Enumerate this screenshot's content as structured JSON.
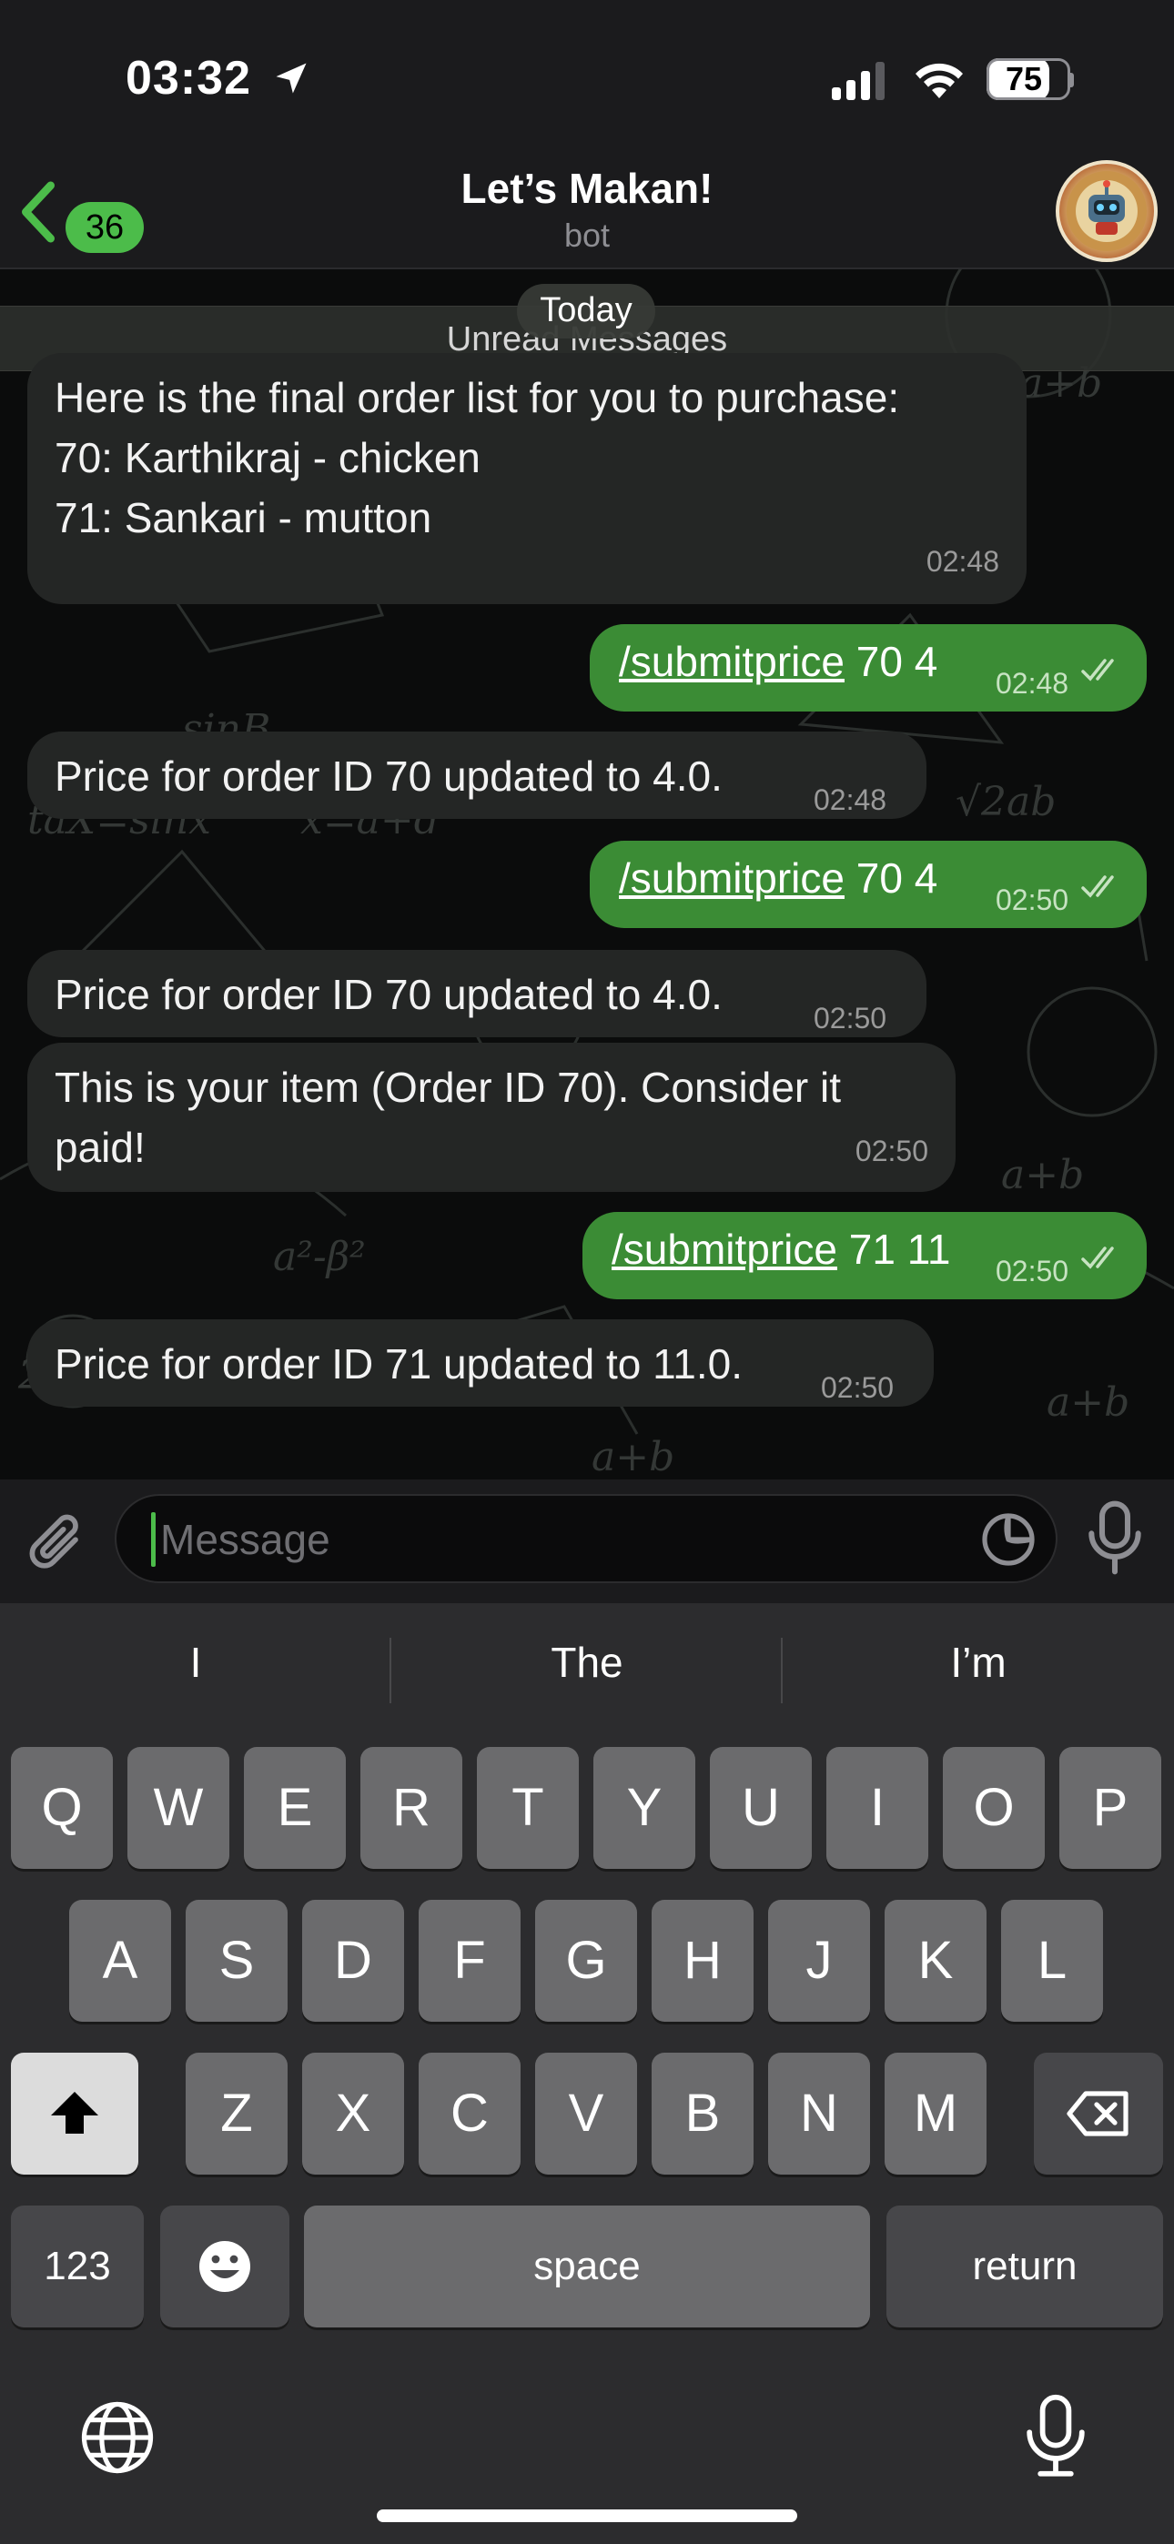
{
  "status_bar": {
    "time": "03:32",
    "battery_percent": "75",
    "battery_level": 0.75
  },
  "header": {
    "back_badge": "36",
    "title": "Let’s Makan!",
    "subtitle": "bot"
  },
  "chat": {
    "date_separator": "Today",
    "unread_label": "Unread Messages",
    "messages": [
      {
        "direction": "in",
        "text": "Here is the final order list for you to purchase:\n70: Karthikraj - chicken\n71: Sankari - mutton",
        "time": "02:48"
      },
      {
        "direction": "out",
        "command": "/submitprice",
        "args": " 70 4",
        "time": "02:48",
        "read": true
      },
      {
        "direction": "in",
        "text": "Price for order ID 70 updated to 4.0.",
        "time": "02:48"
      },
      {
        "direction": "out",
        "command": "/submitprice",
        "args": " 70 4",
        "time": "02:50",
        "read": true
      },
      {
        "direction": "in",
        "text": "Price for order ID 70 updated to 4.0.",
        "time": "02:50"
      },
      {
        "direction": "in",
        "text": "This is your item (Order ID 70). Consider it\npaid!",
        "time": "02:50"
      },
      {
        "direction": "out",
        "command": "/submitprice",
        "args": " 71 11",
        "time": "02:50",
        "read": true
      },
      {
        "direction": "in",
        "text": "Price for order ID 71 updated to 11.0.",
        "time": "02:50"
      }
    ]
  },
  "input": {
    "placeholder": "Message"
  },
  "keyboard": {
    "suggestions": [
      "I",
      "The",
      "I’m"
    ],
    "row1": [
      "Q",
      "W",
      "E",
      "R",
      "T",
      "Y",
      "U",
      "I",
      "O",
      "P"
    ],
    "row2": [
      "A",
      "S",
      "D",
      "F",
      "G",
      "H",
      "J",
      "K",
      "L"
    ],
    "row3": [
      "Z",
      "X",
      "C",
      "V",
      "B",
      "N",
      "M"
    ],
    "numbers_label": "123",
    "space_label": "space",
    "return_label": "return"
  },
  "colors": {
    "accent": "#4cbc4a",
    "outgoing_bubble": "#3b8c35",
    "incoming_bubble": "#242625"
  },
  "icons": [
    "location-arrow-icon",
    "cellular-signal-icon",
    "wifi-icon",
    "battery-icon",
    "back-chevron-icon",
    "paperclip-icon",
    "sticker-icon",
    "microphone-icon",
    "shift-icon",
    "delete-icon",
    "emoji-icon",
    "globe-icon",
    "double-check-icon"
  ]
}
